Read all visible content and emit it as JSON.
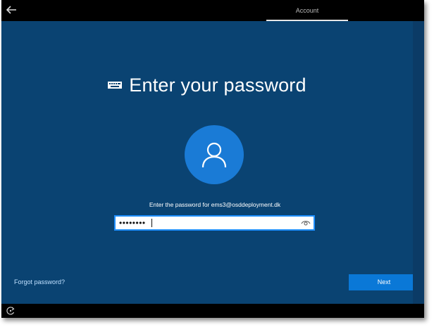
{
  "header": {
    "back_icon": "back-arrow-icon",
    "tab_label": "Account"
  },
  "main": {
    "keyboard_icon": "keyboard-icon",
    "title": "Enter your password",
    "avatar_icon": "user-icon",
    "prompt": "Enter the password for ems3@osddeployment.dk",
    "password": {
      "value": "••••••••",
      "reveal_icon": "eye-icon"
    },
    "forgot_label": "Forgot password?",
    "next_label": "Next"
  },
  "footer": {
    "ease_icon": "ease-of-access-icon"
  },
  "colors": {
    "background": "#0a4372",
    "accent": "#0a78d7",
    "avatar": "#1a7bd6",
    "bar": "#000000"
  }
}
